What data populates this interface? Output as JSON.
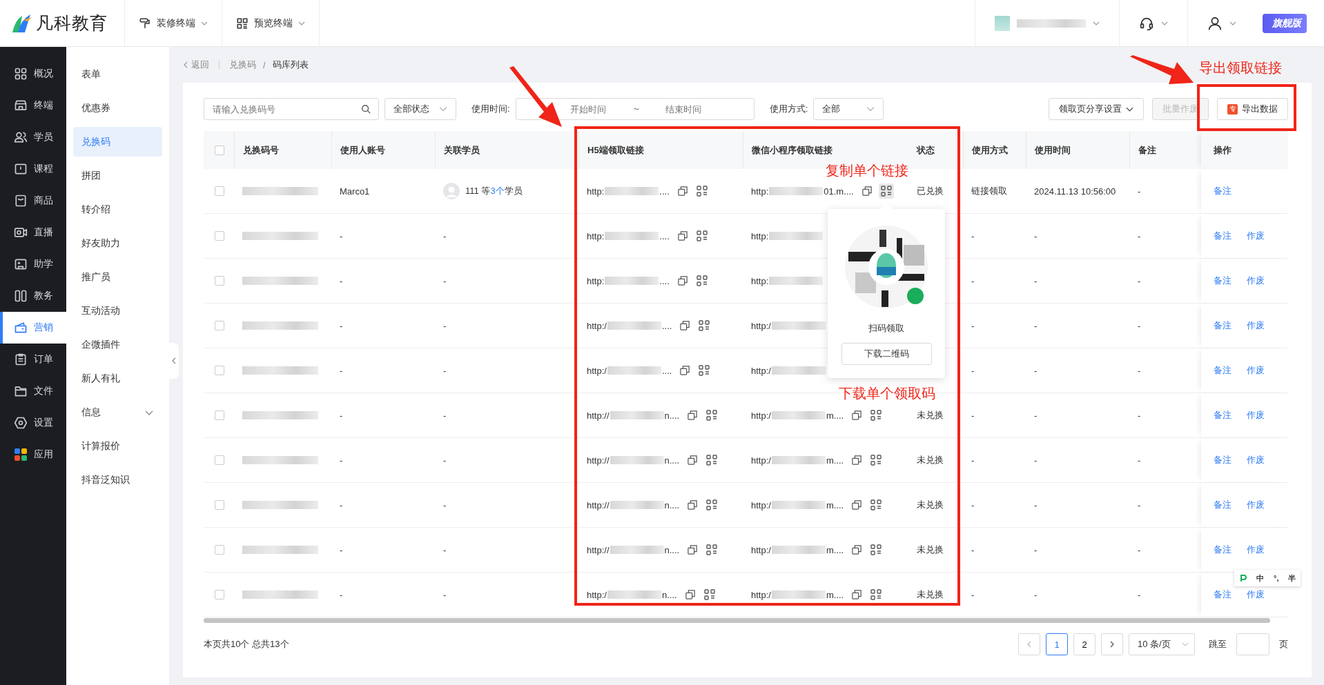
{
  "topbar": {
    "brand": "凡科教育",
    "tools": [
      {
        "label": "装修终端"
      },
      {
        "label": "预览终端"
      }
    ],
    "edition": "旗舰版"
  },
  "nav": {
    "items": [
      {
        "label": "概况",
        "selected": false
      },
      {
        "label": "终端",
        "selected": false
      },
      {
        "label": "学员",
        "selected": false
      },
      {
        "label": "课程",
        "selected": false
      },
      {
        "label": "商品",
        "selected": false
      },
      {
        "label": "直播",
        "selected": false
      },
      {
        "label": "助学",
        "selected": false
      },
      {
        "label": "教务",
        "selected": false
      },
      {
        "label": "营销",
        "selected": true
      },
      {
        "label": "订单",
        "selected": false
      },
      {
        "label": "文件",
        "selected": false
      },
      {
        "label": "设置",
        "selected": false
      },
      {
        "label": "应用",
        "selected": false
      }
    ]
  },
  "submenu": {
    "items": [
      {
        "label": "表单",
        "selected": false
      },
      {
        "label": "优惠券",
        "selected": false
      },
      {
        "label": "兑换码",
        "selected": true
      },
      {
        "label": "拼团",
        "selected": false
      },
      {
        "label": "转介绍",
        "selected": false
      },
      {
        "label": "好友助力",
        "selected": false
      },
      {
        "label": "推广员",
        "selected": false
      },
      {
        "label": "互动活动",
        "selected": false
      },
      {
        "label": "企微插件",
        "selected": false
      },
      {
        "label": "新人有礼",
        "selected": false
      },
      {
        "label": "信息",
        "selected": false,
        "expanded": false
      },
      {
        "label": "计算报价",
        "selected": false
      },
      {
        "label": "抖音泛知识",
        "selected": false
      }
    ]
  },
  "breadcrumb": {
    "back": "返回",
    "separator": "/",
    "items": [
      "兑换码",
      "码库列表"
    ]
  },
  "filters": {
    "search": {
      "placeholder": "请输入兑换码号"
    },
    "status": "全部状态",
    "time_label": "使用时间:",
    "start_placeholder": "开始时间",
    "range_sep": "~",
    "end_placeholder": "结束时间",
    "method_label": "使用方式:",
    "method": "全部"
  },
  "actions": [
    {
      "label": "领取页分享设置",
      "kind": "dropdown",
      "disabled": false
    },
    {
      "label": "批量作废",
      "kind": "plain",
      "disabled": true
    },
    {
      "label": "导出数据",
      "kind": "export",
      "disabled": false,
      "badge": "专"
    }
  ],
  "table": {
    "all_checked": false,
    "columns": [
      "兑换码号",
      "使用人账号",
      "关联学员",
      "H5端领取链接",
      "微信小程序领取链接",
      "状态",
      "使用方式",
      "使用时间",
      "备注",
      "操作"
    ],
    "rows": [
      {
        "checked": false,
        "account": "Marco1",
        "student": {
          "text_before": "111 等",
          "link": "3个",
          "text_after": "学员"
        },
        "h5": {
          "prefix": "http:",
          "suffix": "...."
        },
        "mp": {
          "prefix": "http:",
          "suffix": "01.m....",
          "qr_active": true
        },
        "status": "已兑换",
        "method": "链接领取",
        "time": "2024.11.13 10:56:00",
        "note": "-",
        "ops": [
          "备注"
        ]
      },
      {
        "checked": false,
        "account": "-",
        "student": {
          "text_before": "-"
        },
        "h5": {
          "prefix": "http:",
          "suffix": "...."
        },
        "mp": {
          "prefix": "http:"
        },
        "method": "-",
        "time": "-",
        "note": "-",
        "ops": [
          "备注",
          "作废"
        ]
      },
      {
        "checked": false,
        "account": "-",
        "student": {
          "text_before": "-"
        },
        "h5": {
          "prefix": "http:",
          "suffix": "...."
        },
        "mp": {
          "prefix": "http:"
        },
        "method": "-",
        "time": "-",
        "note": "-",
        "ops": [
          "备注",
          "作废"
        ]
      },
      {
        "checked": false,
        "account": "-",
        "student": {
          "text_before": "-"
        },
        "h5": {
          "prefix": "http:/",
          "suffix": "...."
        },
        "mp": {
          "prefix": "http:/"
        },
        "method": "-",
        "time": "-",
        "note": "-",
        "ops": [
          "备注",
          "作废"
        ]
      },
      {
        "checked": false,
        "account": "-",
        "student": {
          "text_before": "-"
        },
        "h5": {
          "prefix": "http:/",
          "suffix": "...."
        },
        "mp": {
          "prefix": "http:/"
        },
        "method": "-",
        "time": "-",
        "note": "-",
        "ops": [
          "备注",
          "作废"
        ]
      },
      {
        "checked": false,
        "account": "-",
        "student": {
          "text_before": "-"
        },
        "h5": {
          "prefix": "http://",
          "suffix": "n...."
        },
        "mp": {
          "prefix": "http:/",
          "suffix": "m....",
          "qr_active": false
        },
        "status": "未兑换",
        "method": "-",
        "time": "-",
        "note": "-",
        "ops": [
          "备注",
          "作废"
        ]
      },
      {
        "checked": false,
        "account": "-",
        "student": {
          "text_before": "-"
        },
        "h5": {
          "prefix": "http://",
          "suffix": "n...."
        },
        "mp": {
          "prefix": "http:/",
          "suffix": "m....",
          "qr_active": false
        },
        "status": "未兑换",
        "method": "-",
        "time": "-",
        "note": "-",
        "ops": [
          "备注",
          "作废"
        ]
      },
      {
        "checked": false,
        "account": "-",
        "student": {
          "text_before": "-"
        },
        "h5": {
          "prefix": "http://",
          "suffix": "n...."
        },
        "mp": {
          "prefix": "http:/",
          "suffix": "m....",
          "qr_active": false
        },
        "status": "未兑换",
        "method": "-",
        "time": "-",
        "note": "-",
        "ops": [
          "备注",
          "作废"
        ]
      },
      {
        "checked": false,
        "account": "-",
        "student": {
          "text_before": "-"
        },
        "h5": {
          "prefix": "http://",
          "suffix": "n...."
        },
        "mp": {
          "prefix": "http:/",
          "suffix": "m....",
          "qr_active": false
        },
        "status": "未兑换",
        "method": "-",
        "time": "-",
        "note": "-",
        "ops": [
          "备注",
          "作废"
        ]
      },
      {
        "checked": false,
        "account": "-",
        "student": {
          "text_before": "-"
        },
        "h5": {
          "prefix": "http:/",
          "suffix": "n...."
        },
        "mp": {
          "prefix": "http:/",
          "suffix": "m....",
          "qr_active": false
        },
        "status": "未兑换",
        "method": "-",
        "time": "-",
        "note": "-",
        "ops": [
          "备注",
          "作废"
        ]
      }
    ]
  },
  "popup": {
    "caption": "扫码领取",
    "button": "下载二维码"
  },
  "footer": {
    "summary": "本页共10个 总共13个",
    "pages": [
      {
        "label": "1",
        "selected": true
      },
      {
        "label": "2",
        "selected": false
      }
    ],
    "page_size": "10 条/页",
    "jump_label": "跳至",
    "page_unit": "页"
  },
  "annotations": [
    {
      "text": "复制单个链接"
    },
    {
      "text": "下载单个领取码"
    },
    {
      "text": "导出领取链接"
    }
  ],
  "ime": {
    "items": [
      "中",
      "°,",
      "半"
    ]
  }
}
